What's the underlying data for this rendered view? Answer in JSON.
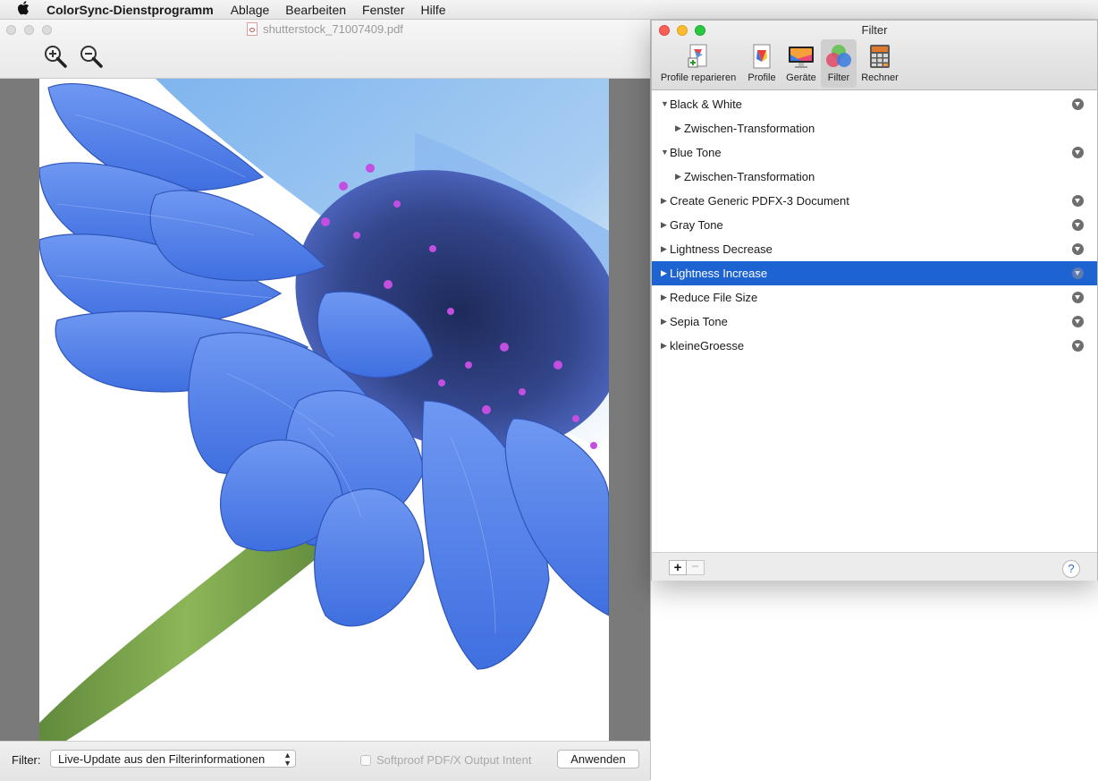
{
  "menubar": {
    "apple_icon": "apple-logo-icon",
    "app_name": "ColorSync-Dienstprogramm",
    "items": [
      "Ablage",
      "Bearbeiten",
      "Fenster",
      "Hilfe"
    ]
  },
  "document": {
    "filename": "shutterstock_71007409.pdf",
    "zoom_in_icon": "zoom-in-icon",
    "zoom_out_icon": "zoom-out-icon",
    "filter_label": "Filter:",
    "filter_value": "Live-Update aus den Filterinformationen",
    "softproof_label": "Softproof PDF/X Output Intent",
    "softproof_checked": false,
    "apply_label": "Anwenden",
    "image_subject": "blue gerbera flower photo"
  },
  "panel": {
    "title": "Filter",
    "toolbar": [
      {
        "label": "Profile reparieren",
        "icon": "profile-repair-icon"
      },
      {
        "label": "Profile",
        "icon": "profile-icon"
      },
      {
        "label": "Geräte",
        "icon": "display-icon"
      },
      {
        "label": "Filter",
        "icon": "filter-icon",
        "active": true
      },
      {
        "label": "Rechner",
        "icon": "calculator-icon"
      }
    ],
    "filters": [
      {
        "label": "Black & White",
        "expanded": true,
        "level": 0,
        "has_action": true
      },
      {
        "label": "Zwischen-Transformation",
        "expanded": false,
        "level": 1,
        "has_action": false
      },
      {
        "label": "Blue Tone",
        "expanded": true,
        "level": 0,
        "has_action": true
      },
      {
        "label": "Zwischen-Transformation",
        "expanded": false,
        "level": 1,
        "has_action": false
      },
      {
        "label": "Create Generic PDFX-3 Document",
        "expanded": false,
        "level": 0,
        "has_action": true
      },
      {
        "label": "Gray Tone",
        "expanded": false,
        "level": 0,
        "has_action": true
      },
      {
        "label": "Lightness Decrease",
        "expanded": false,
        "level": 0,
        "has_action": true
      },
      {
        "label": "Lightness Increase",
        "expanded": false,
        "level": 0,
        "has_action": true,
        "selected": true
      },
      {
        "label": "Reduce File Size",
        "expanded": false,
        "level": 0,
        "has_action": true
      },
      {
        "label": "Sepia Tone",
        "expanded": false,
        "level": 0,
        "has_action": true
      },
      {
        "label": "kleineGroesse",
        "expanded": false,
        "level": 0,
        "has_action": true
      }
    ],
    "add_label": "+",
    "remove_label": "−",
    "help_label": "?"
  },
  "colors": {
    "selection": "#1e63d2",
    "petal": "#5a86ee",
    "stem": "#6a9a3a",
    "flower_center": "#2f3a7a",
    "stamen": "#c34fe0"
  }
}
